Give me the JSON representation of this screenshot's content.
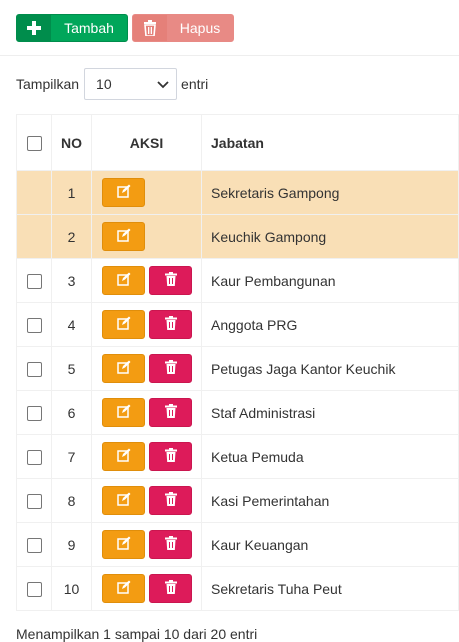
{
  "toolbar": {
    "add_label": "Tambah",
    "delete_label": "Hapus"
  },
  "length_control": {
    "prefix": "Tampilkan",
    "value": "10",
    "suffix": "entri"
  },
  "table": {
    "headers": {
      "no": "NO",
      "aksi": "AKSI",
      "jabatan": "Jabatan"
    },
    "rows": [
      {
        "no": "1",
        "jabatan": "Sekretaris Gampong",
        "selected": true,
        "deletable": false
      },
      {
        "no": "2",
        "jabatan": "Keuchik Gampong",
        "selected": true,
        "deletable": false
      },
      {
        "no": "3",
        "jabatan": "Kaur Pembangunan",
        "selected": false,
        "deletable": true
      },
      {
        "no": "4",
        "jabatan": "Anggota PRG",
        "selected": false,
        "deletable": true
      },
      {
        "no": "5",
        "jabatan": "Petugas Jaga Kantor Keuchik",
        "selected": false,
        "deletable": true
      },
      {
        "no": "6",
        "jabatan": "Staf Administrasi",
        "selected": false,
        "deletable": true
      },
      {
        "no": "7",
        "jabatan": "Ketua Pemuda",
        "selected": false,
        "deletable": true
      },
      {
        "no": "8",
        "jabatan": "Kasi Pemerintahan",
        "selected": false,
        "deletable": true
      },
      {
        "no": "9",
        "jabatan": "Kaur Keuangan",
        "selected": false,
        "deletable": true
      },
      {
        "no": "10",
        "jabatan": "Sekretaris Tuha Peut",
        "selected": false,
        "deletable": true
      }
    ]
  },
  "footer": {
    "info": "Menampilkan 1 sampai 10 dari 20 entri"
  },
  "icons": {
    "add": "plus-icon",
    "delete": "trash-icon",
    "edit": "edit-icon",
    "dropdown": "chevron-down-icon"
  },
  "colors": {
    "add": "#00a65a",
    "delete_disabled": "#e88a85",
    "edit": "#f39c12",
    "trash": "#dd1b5a",
    "selected_row": "#f9dfb6"
  }
}
